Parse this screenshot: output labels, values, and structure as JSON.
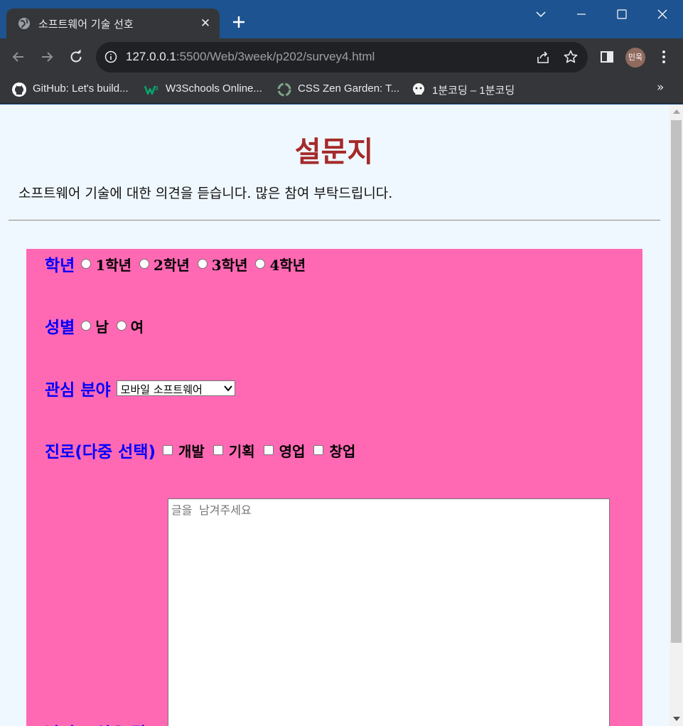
{
  "browser": {
    "tab_title": "소프트웨어 기술 선호",
    "url_host": "127.0.0.1",
    "url_rest": ":5500/Web/3week/p202/survey4.html",
    "profile_initials": "민욱",
    "bookmarks": [
      {
        "label": "GitHub: Let's build...",
        "icon": "github-icon"
      },
      {
        "label": "W3Schools Online...",
        "icon": "w3schools-icon"
      },
      {
        "label": "CSS Zen Garden: T...",
        "icon": "zen-garden-icon"
      },
      {
        "label": "1분코딩 – 1분코딩",
        "icon": "1bun-coding-icon"
      }
    ]
  },
  "page": {
    "title": "설문지",
    "intro": "소프트웨어 기술에 대한 의견을 듣습니다. 많은 참여 부탁드립니다.",
    "form": {
      "grade": {
        "label": "학년",
        "options": [
          "1학년",
          "2학년",
          "3학년",
          "4학년"
        ]
      },
      "gender": {
        "label": "성별",
        "options": [
          "남",
          "여"
        ]
      },
      "interest": {
        "label": "관심 분야",
        "selected": "모바일 소프트웨어"
      },
      "career": {
        "label": "진로(다중 선택)",
        "options": [
          "개발",
          "기획",
          "영업",
          "창업"
        ]
      },
      "comment": {
        "placeholder": "글을 남겨주세요",
        "label": "남기고 싶은 말"
      }
    }
  },
  "colors": {
    "page_bg": "#f0f8ff",
    "title": "#a52a2a",
    "form_bg": "#ff69b4",
    "label": "#0000ff"
  }
}
